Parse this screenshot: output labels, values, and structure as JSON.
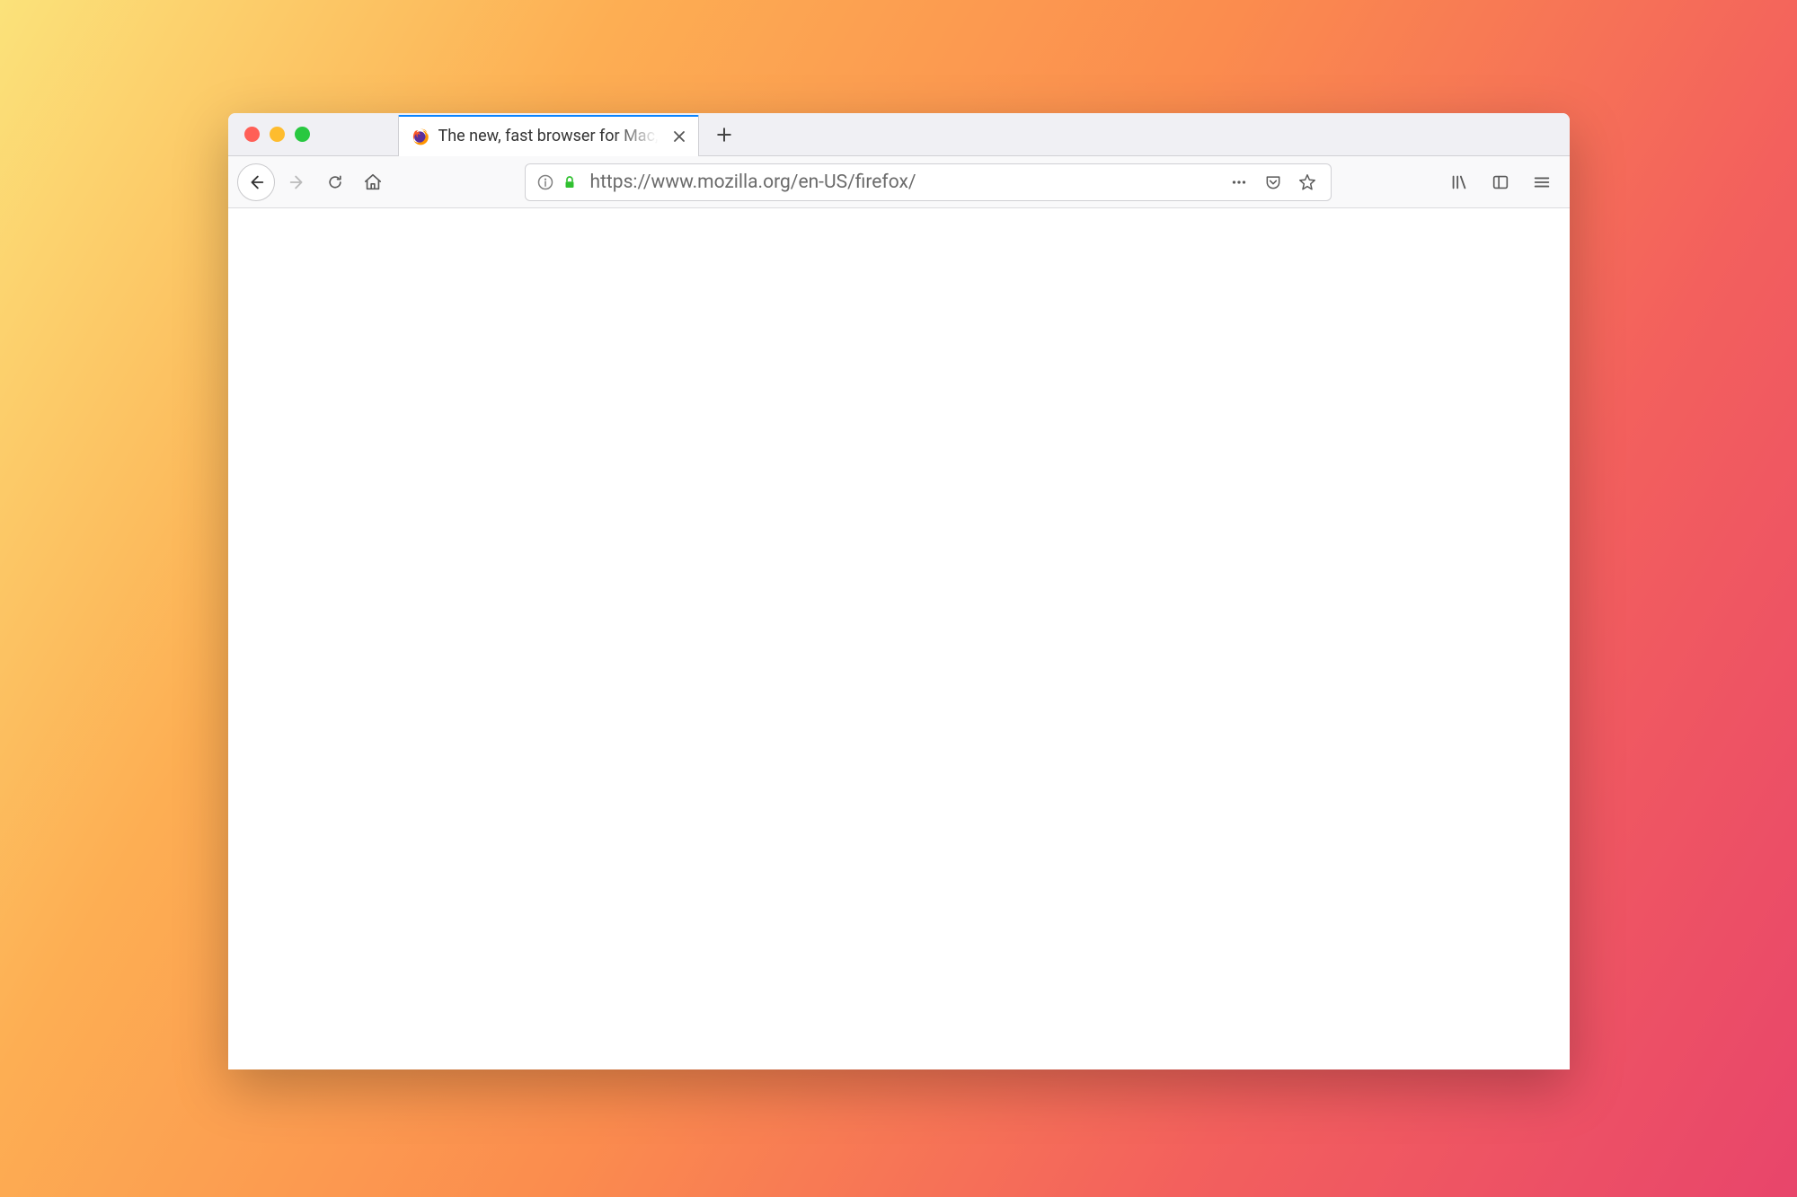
{
  "tab": {
    "title": "The new, fast browser for Mac, PC and Linux"
  },
  "urlbar": {
    "url": "https://www.mozilla.org/en-US/firefox/"
  }
}
